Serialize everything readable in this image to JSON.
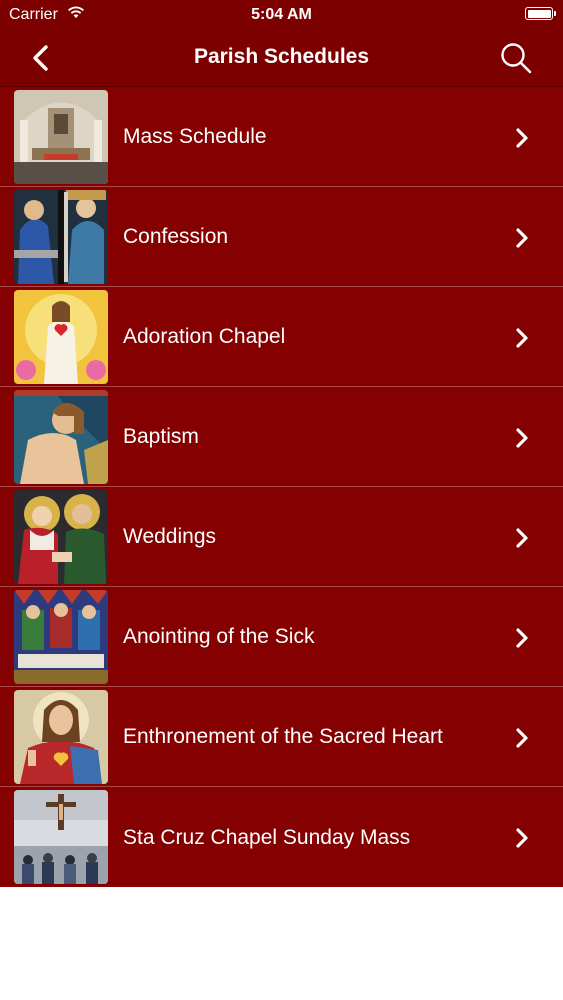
{
  "status_bar": {
    "carrier": "Carrier",
    "time": "5:04 AM"
  },
  "nav": {
    "title": "Parish Schedules",
    "back_icon": "chevron-left-icon",
    "search_icon": "search-icon"
  },
  "colors": {
    "bar": "#7d0000",
    "list_bg": "#850000",
    "separator": "#a84848",
    "text": "#ffffff"
  },
  "items": [
    {
      "label": "Mass Schedule"
    },
    {
      "label": "Confession"
    },
    {
      "label": "Adoration Chapel"
    },
    {
      "label": "Baptism"
    },
    {
      "label": "Weddings"
    },
    {
      "label": "Anointing of the Sick"
    },
    {
      "label": "Enthronement of the Sacred Heart"
    },
    {
      "label": "Sta Cruz Chapel Sunday Mass"
    }
  ]
}
